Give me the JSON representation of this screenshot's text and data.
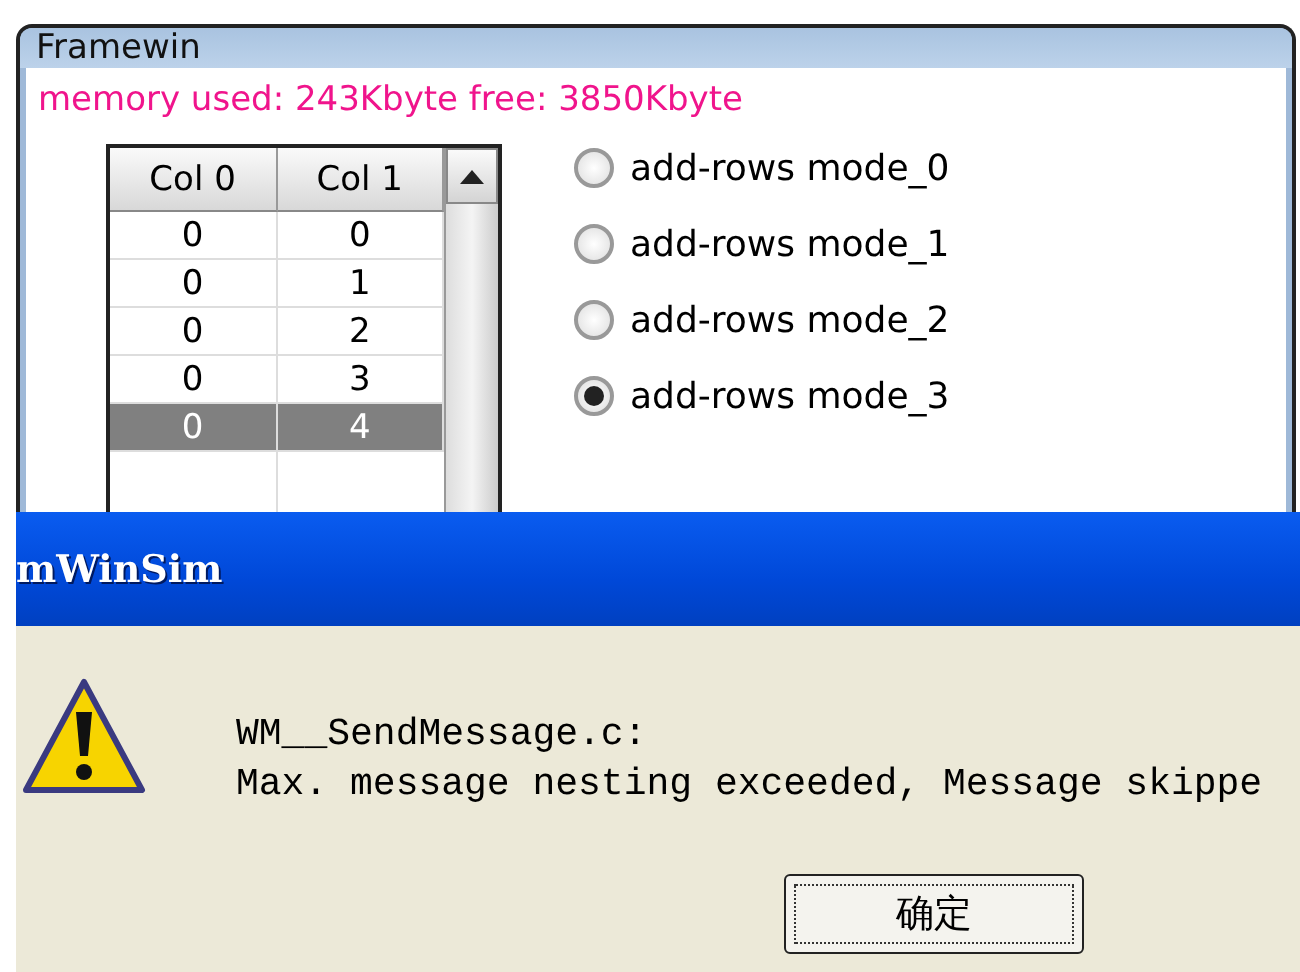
{
  "framewin": {
    "title": "Framewin",
    "memory_text": "memory used: 243Kbyte free: 3850Kbyte",
    "table": {
      "columns": [
        "Col 0",
        "Col 1"
      ],
      "rows": [
        {
          "cells": [
            "0",
            "0"
          ],
          "selected": false
        },
        {
          "cells": [
            "0",
            "1"
          ],
          "selected": false
        },
        {
          "cells": [
            "0",
            "2"
          ],
          "selected": false
        },
        {
          "cells": [
            "0",
            "3"
          ],
          "selected": false
        },
        {
          "cells": [
            "0",
            "4"
          ],
          "selected": true
        }
      ]
    },
    "radios": [
      {
        "label": "add-rows mode_0",
        "selected": false
      },
      {
        "label": "add-rows mode_1",
        "selected": false
      },
      {
        "label": "add-rows mode_2",
        "selected": false
      },
      {
        "label": "add-rows mode_3",
        "selected": true
      }
    ]
  },
  "dialog": {
    "title": "mWinSim",
    "message_lines": [
      "WM__SendMessage.c:",
      "Max. message nesting exceeded, Message skippe"
    ],
    "buttons": [
      "确定"
    ]
  }
}
